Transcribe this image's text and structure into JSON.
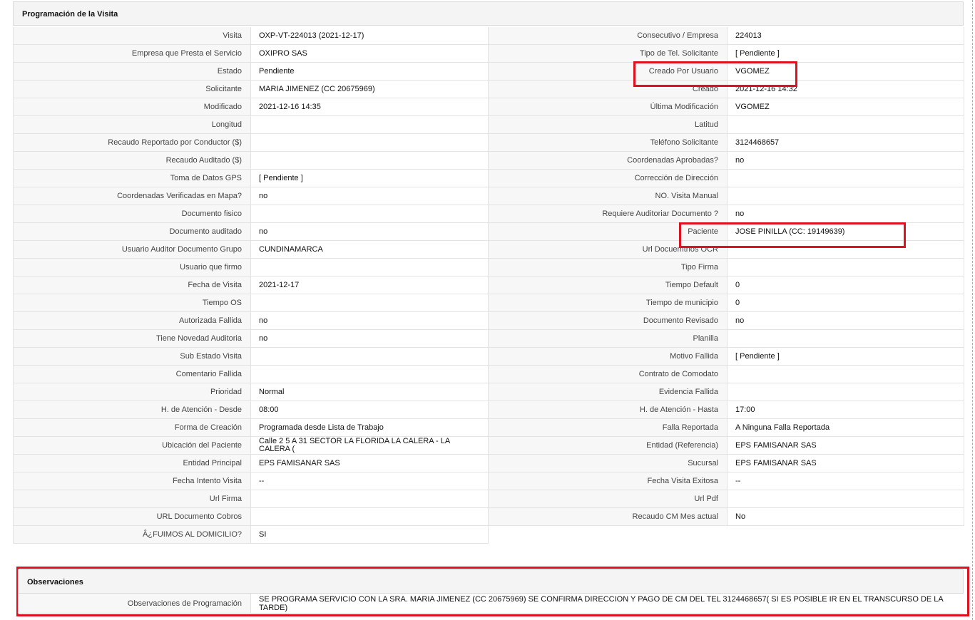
{
  "programacion": {
    "title": "Programación de la Visita",
    "rows": [
      {
        "l1": "Visita",
        "v1": "OXP-VT-224013 (2021-12-17)",
        "l2": "Consecutivo / Empresa",
        "v2": "224013"
      },
      {
        "l1": "Empresa que Presta el Servicio",
        "v1": "OXIPRO SAS",
        "l2": "Tipo de Tel. Solicitante",
        "v2": "[ Pendiente ]"
      },
      {
        "l1": "Estado",
        "v1": "Pendiente",
        "l2": "Creado Por Usuario",
        "v2": "VGOMEZ"
      },
      {
        "l1": "Solicitante",
        "v1": "MARIA JIMENEZ (CC 20675969)",
        "l2": "Creado",
        "v2": "2021-12-16 14:32"
      },
      {
        "l1": "Modificado",
        "v1": "2021-12-16 14:35",
        "l2": "Última Modificación",
        "v2": " VGOMEZ"
      },
      {
        "l1": "Longitud",
        "v1": "",
        "l2": "Latitud",
        "v2": ""
      },
      {
        "l1": "Recaudo Reportado por Conductor ($)",
        "v1": "",
        "l2": "Teléfono Solicitante",
        "v2": "3124468657"
      },
      {
        "l1": "Recaudo Auditado ($)",
        "v1": "",
        "l2": "Coordenadas Aprobadas?",
        "v2": " no"
      },
      {
        "l1": "Toma de Datos GPS",
        "v1": "[ Pendiente ]",
        "l2": "Corrección de Dirección",
        "v2": ""
      },
      {
        "l1": "Coordenadas Verificadas en Mapa?",
        "v1": " no",
        "l2": "NO. Visita Manual",
        "v2": ""
      },
      {
        "l1": "Documento fisico",
        "v1": "",
        "l2": "Requiere Auditoriar Documento ?",
        "v2": " no"
      },
      {
        "l1": "Documento auditado",
        "v1": " no",
        "l2": "Paciente",
        "v2": "JOSE PINILLA (CC: 19149639)"
      },
      {
        "l1": "Usuario Auditor Documento Grupo",
        "v1": "CUNDINAMARCA",
        "l2": "Url Docuemtnos OCR",
        "v2": ""
      },
      {
        "l1": "Usuario que firmo",
        "v1": "",
        "l2": "Tipo Firma",
        "v2": ""
      },
      {
        "l1": "Fecha de Visita",
        "v1": " 2021-12-17",
        "l2": "Tiempo Default",
        "v2": "0"
      },
      {
        "l1": "Tiempo OS",
        "v1": "",
        "l2": "Tiempo de municipio",
        "v2": "0"
      },
      {
        "l1": "Autorizada Fallida",
        "v1": " no",
        "l2": "Documento Revisado",
        "v2": " no"
      },
      {
        "l1": "Tiene Novedad Auditoria",
        "v1": " no",
        "l2": "Planilla",
        "v2": ""
      },
      {
        "l1": "Sub Estado Visita",
        "v1": "",
        "l2": "Motivo Fallida",
        "v2": "[ Pendiente ]"
      },
      {
        "l1": "Comentario Fallida",
        "v1": "",
        "l2": "Contrato de Comodato",
        "v2": ""
      },
      {
        "l1": "Prioridad",
        "v1": "Normal",
        "l2": "Evidencia Fallida",
        "v2": ""
      },
      {
        "l1": "H. de Atención - Desde",
        "v1": "08:00",
        "l2": "H. de Atención - Hasta",
        "v2": "17:00"
      },
      {
        "l1": "Forma de Creación",
        "v1": "Programada desde Lista de Trabajo",
        "l2": "Falla Reportada",
        "v2": "A Ninguna Falla Reportada"
      },
      {
        "l1": "Ubicación del Paciente",
        "v1": "Calle 2 5 A 31 SECTOR LA FLORIDA LA CALERA - LA CALERA (",
        "l2": "Entidad (Referencia)",
        "v2": "EPS FAMISANAR SAS"
      },
      {
        "l1": "Entidad Principal",
        "v1": "EPS FAMISANAR SAS",
        "l2": "Sucursal",
        "v2": "EPS FAMISANAR SAS"
      },
      {
        "l1": "Fecha Intento Visita",
        "v1": " --",
        "l2": "Fecha Visita Exitosa",
        "v2": " --"
      },
      {
        "l1": "Url Firma",
        "v1": "",
        "l2": "Url Pdf",
        "v2": ""
      },
      {
        "l1": "URL Documento Cobros",
        "v1": "",
        "l2": "Recaudo CM Mes actual",
        "v2": "No"
      },
      {
        "l1": "Â¿FUIMOS AL DOMICILIO?",
        "v1": "SI"
      }
    ]
  },
  "observaciones": {
    "title": "Observaciones",
    "label": "Observaciones de Programación",
    "value": " SE PROGRAMA SERVICIO CON LA SRA. MARIA JIMENEZ (CC 20675969) SE CONFIRMA DIRECCION Y PAGO DE CM DEL TEL 3124468657( SI ES POSIBLE IR EN EL TRANSCURSO DE LA TARDE)"
  },
  "colors": {
    "highlight": "#e0111f",
    "label_bg": "#f7f7f7",
    "header_bg": "#f4f4f4"
  }
}
